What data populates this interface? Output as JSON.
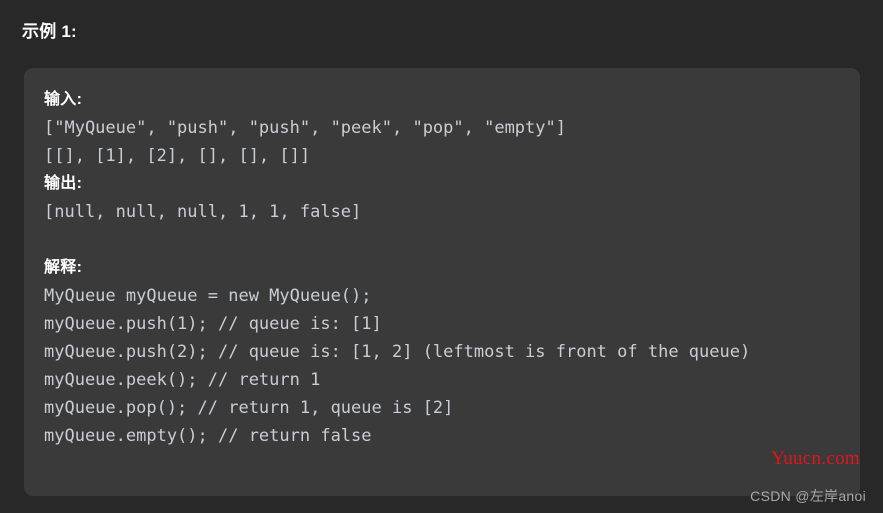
{
  "section": {
    "title": "示例 1:"
  },
  "code_block": {
    "lines": [
      {
        "kind": "label",
        "text": "输入:"
      },
      {
        "kind": "code",
        "text": "[\"MyQueue\", \"push\", \"push\", \"peek\", \"pop\", \"empty\"]"
      },
      {
        "kind": "code",
        "text": "[[], [1], [2], [], [], []]"
      },
      {
        "kind": "label",
        "text": "输出:"
      },
      {
        "kind": "code",
        "text": "[null, null, null, 1, 1, false]"
      },
      {
        "kind": "blank",
        "text": ""
      },
      {
        "kind": "label",
        "text": "解释:"
      },
      {
        "kind": "code",
        "text": "MyQueue myQueue = new MyQueue();"
      },
      {
        "kind": "code",
        "text": "myQueue.push(1); // queue is: [1]"
      },
      {
        "kind": "code",
        "text": "myQueue.push(2); // queue is: [1, 2] (leftmost is front of the queue)"
      },
      {
        "kind": "code",
        "text": "myQueue.peek(); // return 1"
      },
      {
        "kind": "code",
        "text": "myQueue.pop(); // return 1, queue is [2]"
      },
      {
        "kind": "code",
        "text": "myQueue.empty(); // return false"
      }
    ]
  },
  "watermarks": {
    "site": "Yuucn.com",
    "author": "CSDN @左岸anoi"
  },
  "colors": {
    "page_background": "#282828",
    "code_background": "#3a3a3a",
    "code_text": "#c9ced5",
    "label_text": "#ffffff",
    "watermark_site": "#e3151a",
    "watermark_author": "#a8a8a8"
  }
}
